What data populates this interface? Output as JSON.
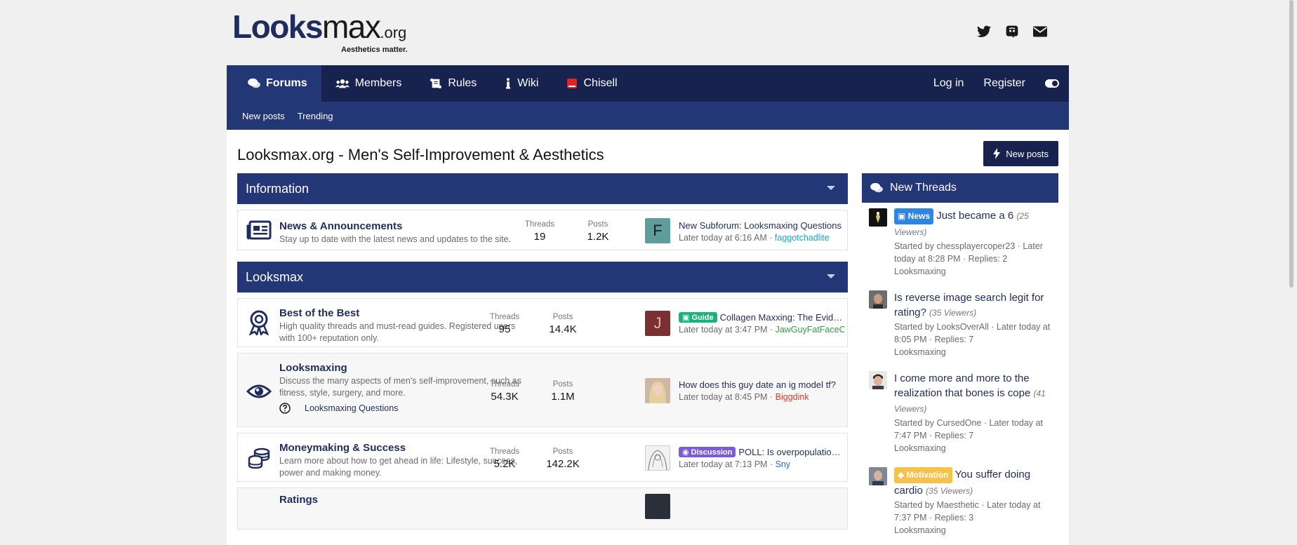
{
  "header": {
    "logo_a": "Looks",
    "logo_b": "max",
    "logo_org": ".org",
    "tagline": "Aesthetics matter."
  },
  "nav": {
    "forums": "Forums",
    "members": "Members",
    "rules": "Rules",
    "wiki": "Wiki",
    "chisell": "Chisell",
    "login": "Log in",
    "register": "Register"
  },
  "subnav": {
    "new_posts": "New posts",
    "trending": "Trending"
  },
  "page": {
    "title": "Looksmax.org - Men's Self-Improvement & Aesthetics",
    "new_posts_button": "New posts"
  },
  "labels": {
    "threads": "Threads",
    "posts": "Posts"
  },
  "categories": [
    {
      "title": "Information",
      "nodes": [
        {
          "title": "News & Announcements",
          "desc": "Stay up to date with the latest news and updates to the site.",
          "threads": "19",
          "posts": "1.2K",
          "avatar_letter": "F",
          "avatar_color": "#5e9e9a",
          "latest_title": "New Subforum: Looksmaxing Questions",
          "latest_time": "Later today at 6:16 AM",
          "latest_user": "faggotchadlite",
          "user_color": "#18a8c0"
        }
      ]
    },
    {
      "title": "Looksmax",
      "nodes": [
        {
          "title": "Best of the Best",
          "desc": "High quality threads and must-read guides. Registered users with 100+ reputation only.",
          "threads": "95",
          "posts": "14.4K",
          "avatar_letter": "J",
          "avatar_color": "#7a3030",
          "prefix": "Guide",
          "prefix_color": "#19b37a",
          "latest_title": "Collagen Maxxing: The Evidence",
          "latest_time": "Later today at 3:47 PM",
          "latest_user": "JawGuyFatFaceCel",
          "user_color": "#2ea043"
        },
        {
          "title": "Looksmaxing",
          "desc": "Discuss the many aspects of men's self-improvement, such as fitness, style, surgery, and more.",
          "threads": "54.3K",
          "posts": "1.1M",
          "sub_forum": "Looksmaxing Questions",
          "latest_title": "How does this guy date an ig model tf?",
          "latest_time": "Later today at 8:45 PM",
          "latest_user": "Biggdink",
          "user_color": "#e0392d"
        },
        {
          "title": "Moneymaking & Success",
          "desc": "Learn more about how to get ahead in life: Lifestyle, success, power and making money.",
          "threads": "5.2K",
          "posts": "142.2K",
          "prefix": "Discussion",
          "prefix_color": "#7b5bd6",
          "latest_title": "POLL: Is overpopulation a problem",
          "latest_time": "Later today at 7:13 PM",
          "latest_user": "Sny",
          "user_color": "#3a66c4"
        },
        {
          "title": "Ratings"
        }
      ]
    }
  ],
  "sidebar": {
    "title": "New Threads",
    "threads": [
      {
        "prefix": "News",
        "prefix_color": "#2f86e0",
        "title": "Just became a 6",
        "views": "(25 Viewers)",
        "meta": "Started by chessplayercoper23 · Later today at 8:28 PM · Replies: 2",
        "forum": "Looksmaxing"
      },
      {
        "title": "Is reverse image search legit for rating?",
        "views": "(35 Viewers)",
        "meta": "Started by LooksOverAll · Later today at 8:05 PM · Replies: 7",
        "forum": "Looksmaxing"
      },
      {
        "title": "I come more and more to the realization that bones is cope",
        "views": "(41 Viewers)",
        "meta": "Started by CursedOne · Later today at 7:47 PM · Replies: 7",
        "forum": "Looksmaxing"
      },
      {
        "prefix": "Motivation",
        "prefix_color": "#f6c24a",
        "title": "You suffer doing cardio",
        "views": "(35 Viewers)",
        "meta": "Started by Maesthetic · Later today at 7:37 PM · Replies: 3",
        "forum": "Looksmaxing"
      }
    ]
  }
}
